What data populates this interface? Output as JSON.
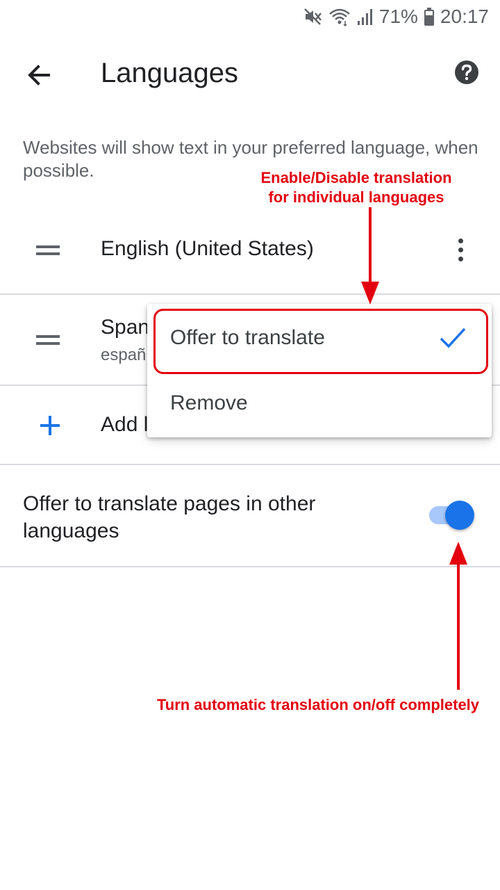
{
  "status_bar": {
    "battery_percent": "71%",
    "time": "20:17"
  },
  "header": {
    "title": "Languages"
  },
  "description": "Websites will show text in your preferred language, when possible.",
  "languages": [
    {
      "name": "English (United States)",
      "native": ""
    },
    {
      "name": "Span",
      "native": "españ"
    }
  ],
  "add_language_label": "Add l",
  "popup_menu": {
    "items": [
      {
        "label": "Offer to translate",
        "checked": true
      },
      {
        "label": "Remove",
        "checked": false
      }
    ]
  },
  "translate_setting": {
    "label": "Offer to translate pages in other languages",
    "enabled": true
  },
  "annotations": {
    "top_line1": "Enable/Disable translation",
    "top_line2": "for individual languages",
    "bottom": "Turn automatic translation on/off completely"
  },
  "colors": {
    "accent": "#1a73e8",
    "annotation": "#e3000f"
  }
}
